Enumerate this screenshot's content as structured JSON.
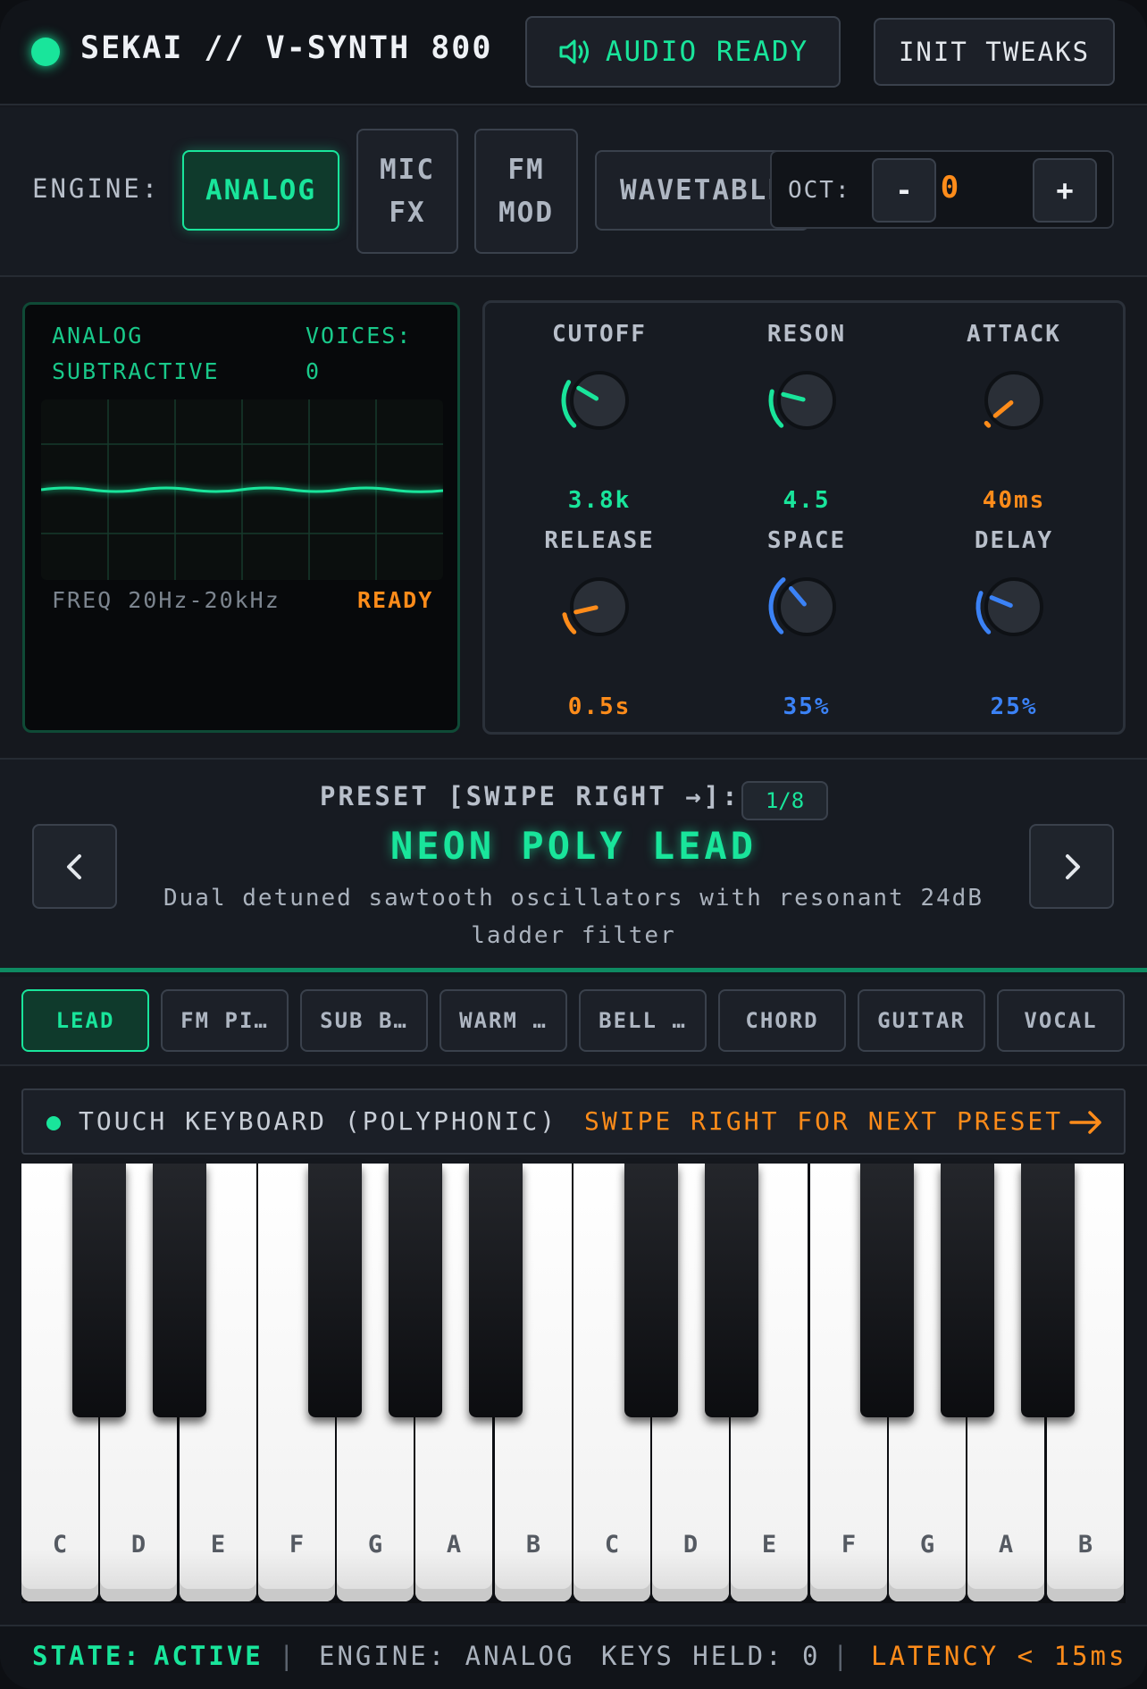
{
  "header": {
    "title": "SEKAI // V-SYNTH 800",
    "audio_button": "AUDIO READY",
    "init_button": "INIT TWEAKS"
  },
  "engine": {
    "label": "ENGINE:",
    "options": [
      {
        "label": "ANALOG",
        "active": true
      },
      {
        "label": "MIC FX",
        "active": false
      },
      {
        "label": "FM MOD",
        "active": false
      },
      {
        "label": "WAVETABLE",
        "active": false
      }
    ],
    "octave_label": "OCT:",
    "octave_minus": "-",
    "octave_value": "0",
    "octave_plus": "+"
  },
  "scope": {
    "mode_line1": "ANALOG",
    "mode_line2": "SUBTRACTIVE",
    "voices_label": "VOICES:",
    "voices_value": "0",
    "freq_label": "FREQ 20Hz-20kHz",
    "status": "READY"
  },
  "knobs": [
    {
      "label": "CUTOFF",
      "value": "3.8k",
      "level": 0.28,
      "color": "#19e59b"
    },
    {
      "label": "RESON",
      "value": "4.5",
      "level": 0.22,
      "color": "#19e59b"
    },
    {
      "label": "ATTACK",
      "value": "40ms",
      "level": 0.02,
      "color": "#ff8c1a"
    },
    {
      "label": "RELEASE",
      "value": "0.5s",
      "level": 0.12,
      "color": "#ff8c1a"
    },
    {
      "label": "SPACE",
      "value": "35%",
      "level": 0.35,
      "color": "#3b82f6"
    },
    {
      "label": "DELAY",
      "value": "25%",
      "level": 0.25,
      "color": "#3b82f6"
    }
  ],
  "preset": {
    "heading": "PRESET [SWIPE RIGHT →]:",
    "count": "1/8",
    "name": "NEON POLY LEAD",
    "description": "Dual detuned sawtooth oscillators with resonant 24dB ladder filter"
  },
  "preset_tabs": [
    "LEAD",
    "FM PI…",
    "SUB B…",
    "WARM …",
    "BELL …",
    "CHORD",
    "GUITAR",
    "VOCAL"
  ],
  "keyboard": {
    "title": "TOUCH KEYBOARD (POLYPHONIC)",
    "hint": "SWIPE RIGHT FOR NEXT PRESET",
    "white_keys": [
      "C",
      "D",
      "E",
      "F",
      "G",
      "A",
      "B",
      "C",
      "D",
      "E",
      "F",
      "G",
      "A",
      "B"
    ]
  },
  "status": {
    "state_label": "STATE:",
    "state_value": "ACTIVE",
    "engine_text": "ENGINE: ANALOG",
    "keys_text": "KEYS HELD: 0",
    "latency_text": "LATENCY < 15ms",
    "separator": "|"
  },
  "colors": {
    "accent": "#19e59b",
    "warning": "#ff8c1a",
    "blue": "#3b82f6"
  }
}
